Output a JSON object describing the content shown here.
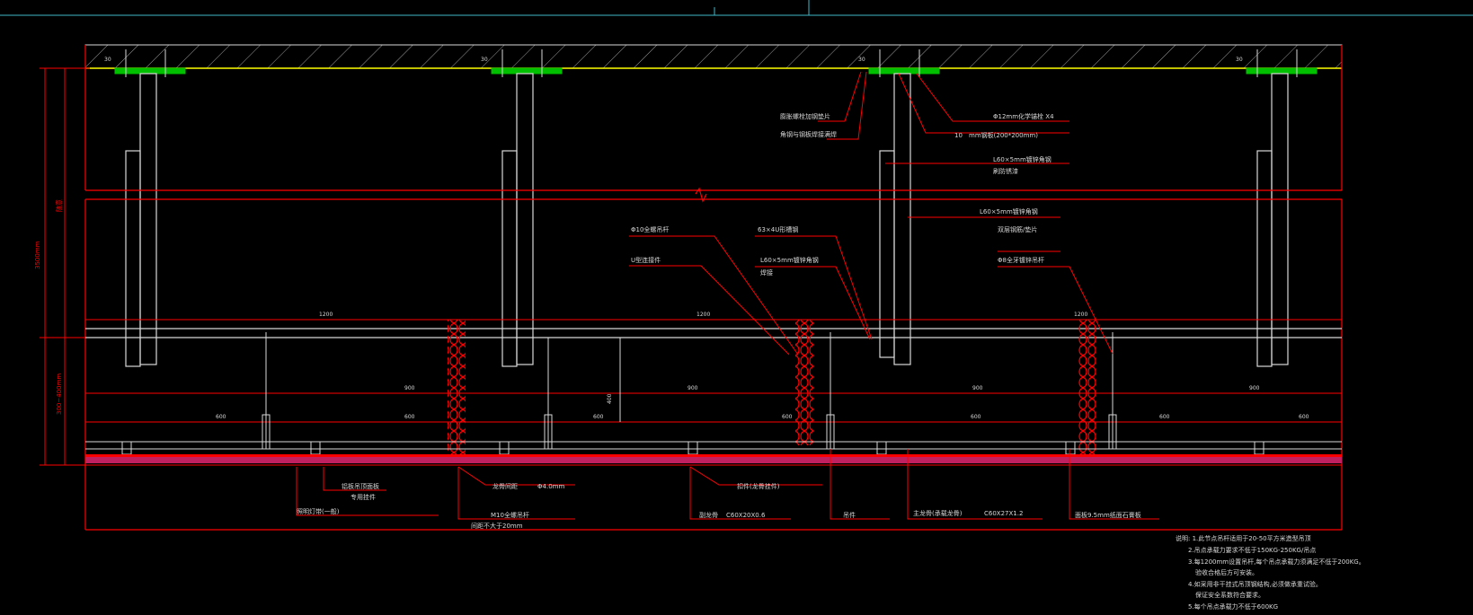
{
  "colors": {
    "background": "#000000",
    "cad_red": "#ff0000",
    "cad_white": "#d8d8d8",
    "cad_yellow": "#ffff00",
    "cad_green": "#00c000",
    "cad_cyan": "#3fb8c8",
    "cad_magenta": "#ff00ff"
  },
  "dimensions": {
    "total_height": "3500mm",
    "upper_height": "随意",
    "lower_height": "300~400mm",
    "span_upper": [
      "1200",
      "1200",
      "1200"
    ],
    "span_mid": [
      "900",
      "900",
      "900",
      "900"
    ],
    "span_lower": [
      "600",
      "600",
      "600",
      "600",
      "600",
      "600",
      "600"
    ],
    "hanger_drop": "400",
    "anchor_marks": [
      "30",
      "30",
      "30",
      "30"
    ]
  },
  "labels_top": {
    "l1": "膨胀螺栓加钢垫片",
    "l2": "角钢与钢板焊接满焊",
    "l3": "Φ12mm化学锚栓  X4",
    "l4_num": "10",
    "l4": "mm钢板(200*200mm)",
    "l5": "L60×5mm镀锌角钢",
    "l6": "刷防锈漆"
  },
  "labels_middle": {
    "m1": "L60×5mm镀锌角钢",
    "m2": "Φ10全螺吊杆",
    "m3": "63×4U形槽钢",
    "m4": "双层钢筋/垫片",
    "m5": "U型连接件",
    "m6": "L60×5mm镀锌角钢",
    "m7": "焊接",
    "m8": "Φ8全牙镀锌吊杆"
  },
  "labels_bottom": {
    "b1": "铝板吊顶面板",
    "b1b": "专用挂件",
    "b2": "龙骨间距",
    "b2_val": "Φ4.0mm",
    "b3": "扣件(龙骨挂件)",
    "b4": "照明灯带(一般)",
    "b5": "M10全螺吊杆",
    "b5b": "间距不大于20mm",
    "b6": "副龙骨",
    "b6_val": "C60X20X0.6",
    "b7": "吊件",
    "b8": "主龙骨(承载龙骨)",
    "b8_val": "C60X27X1.2",
    "b9": "面板9.5mm纸面石膏板"
  },
  "notes": {
    "n1": "说明: 1.此节点吊杆适用于20-50平方米造型吊顶",
    "n2": "2.吊点承载力要求不低于150KG-250KG/吊点",
    "n3": "3.每1200mm设置吊杆,每个吊点承载力须满足不低于200KG。",
    "n3b": "验收合格后方可安装。",
    "n4": "4.如采用非干挂式吊顶钢结构,必须做承重试验。",
    "n4b": "保证安全系数符合要求。",
    "n5": "5.每个吊点承载力不低于600KG"
  }
}
